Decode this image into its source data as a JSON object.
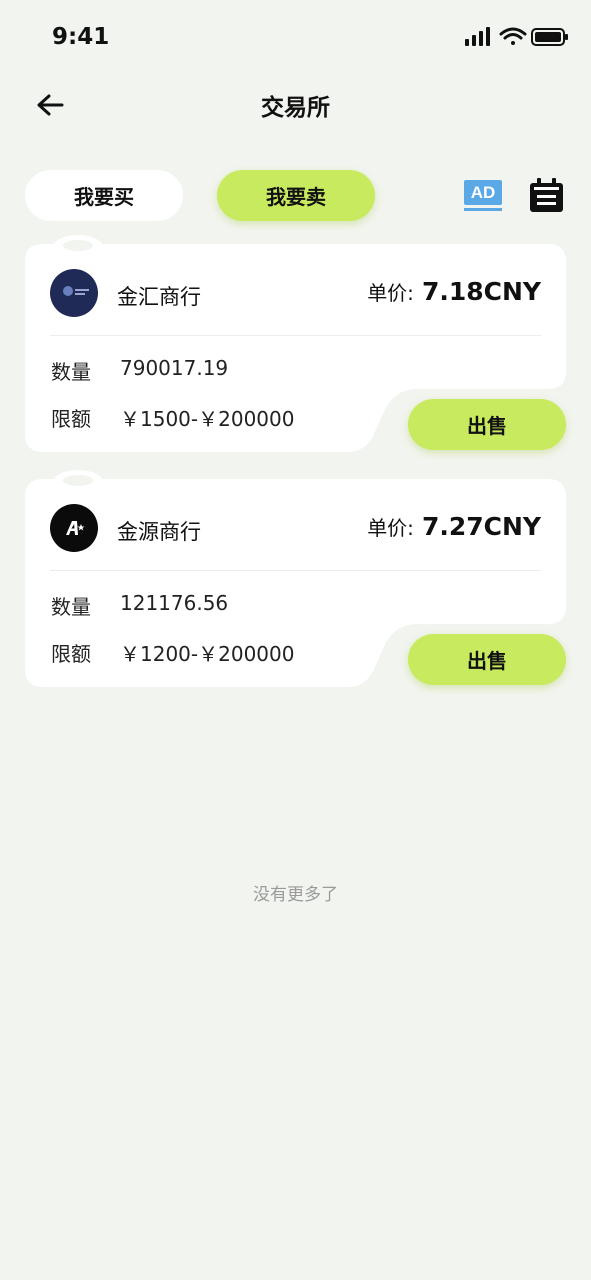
{
  "status_bar": {
    "time": "9:41"
  },
  "nav": {
    "title": "交易所",
    "back_icon": "arrow-left-icon"
  },
  "tabs": [
    {
      "label": "我要买",
      "active": false
    },
    {
      "label": "我要卖",
      "active": true
    }
  ],
  "toolbar": {
    "ad_label": "AD",
    "calendar_icon": "calendar-icon"
  },
  "offers": [
    {
      "merchant": "金汇商行",
      "price_label": "单价:",
      "price": "7.18CNY",
      "qty_label": "数量",
      "qty": "790017.19",
      "limit_label": "限额",
      "limit": "￥1500-￥200000",
      "action": "出售"
    },
    {
      "merchant": "金源商行",
      "price_label": "单价:",
      "price": "7.27CNY",
      "qty_label": "数量",
      "qty": "121176.56",
      "limit_label": "限额",
      "limit": "￥1200-￥200000",
      "action": "出售"
    }
  ],
  "footer": {
    "no_more": "没有更多了"
  },
  "colors": {
    "accent": "#c8ea5e",
    "background": "#f2f4ef",
    "ad_blue": "#5aa9e6"
  }
}
